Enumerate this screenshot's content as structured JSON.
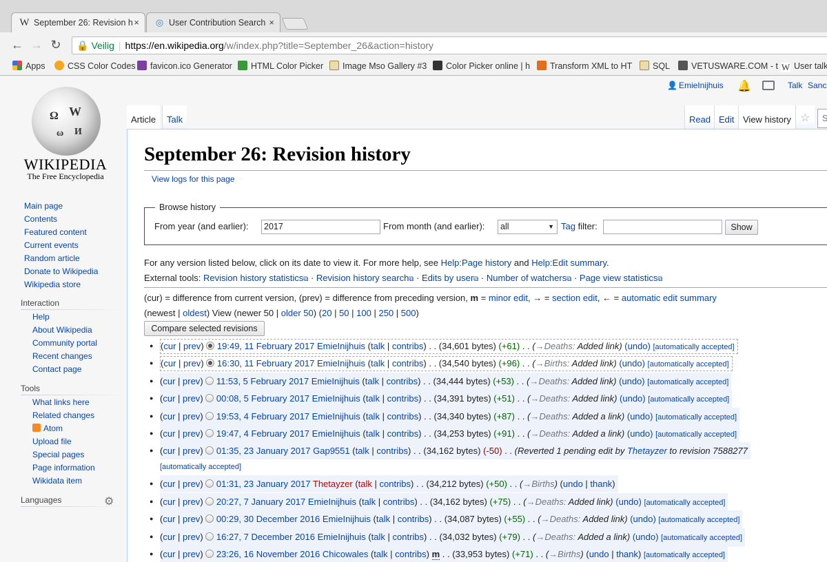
{
  "browser": {
    "tabs": [
      {
        "title": "September 26: Revision h",
        "close": "×",
        "icon": "W"
      },
      {
        "title": "User Contribution Search",
        "close": "×",
        "icon": "◎"
      }
    ],
    "address": {
      "secure_label": "Veilig",
      "host": "https://en.wikipedia.org",
      "path": "/w/index.php?title=September_26&action=history"
    },
    "bookmarks": [
      {
        "label": "Apps",
        "color": "#e04a3f"
      },
      {
        "label": "CSS Color Codes",
        "color": "#f5a623"
      },
      {
        "label": "favicon.ico Generator",
        "color": "#7b3fa0"
      },
      {
        "label": "HTML Color Picker",
        "color": "#3a9a3a"
      },
      {
        "label": "Image Mso Gallery #3",
        "color": "#c8b070"
      },
      {
        "label": "Color Picker online | h",
        "color": "#333333"
      },
      {
        "label": "Transform XML to HT",
        "color": "#e07020"
      },
      {
        "label": "SQL",
        "color": "#c8b070"
      },
      {
        "label": "VETUSWARE.COM - t",
        "color": "#555555"
      },
      {
        "label": "User talk:",
        "color": "#ffffff"
      }
    ]
  },
  "wiki": {
    "wordmark": "WIKIPEDIA",
    "tagline": "The Free Encyclopedia",
    "globe_glyphs": [
      "Ω",
      "W",
      "И",
      "ω"
    ],
    "nav": [
      "Main page",
      "Contents",
      "Featured content",
      "Current events",
      "Random article",
      "Donate to Wikipedia",
      "Wikipedia store"
    ],
    "interaction_heading": "Interaction",
    "interaction": [
      "Help",
      "About Wikipedia",
      "Community portal",
      "Recent changes",
      "Contact page"
    ],
    "tools_heading": "Tools",
    "tools": [
      "What links here",
      "Related changes",
      "Atom",
      "Upload file",
      "Special pages",
      "Page information",
      "Wikidata item"
    ],
    "languages_heading": "Languages",
    "user": "EmieInijhuis",
    "talk": "Talk",
    "sandbox": "Sanc",
    "tab_article": "Article",
    "tab_talk": "Talk",
    "tab_read": "Read",
    "tab_edit": "Edit",
    "tab_history": "View history",
    "search_placeholder": "S"
  },
  "page": {
    "title": "September 26: Revision history",
    "view_logs": "View logs for this page",
    "browse_legend": "Browse history",
    "from_year_label": "From year (and earlier):",
    "from_year_value": "2017",
    "from_month_label": "From month (and earlier):",
    "from_month_value": "all",
    "tag_link": "Tag",
    "tag_filter_label": " filter:",
    "show_button": "Show",
    "help_pre": "For any version listed below, click on its date to view it. For more help, see ",
    "help_link1": "Help:Page history",
    "help_mid": " and ",
    "help_link2": "Help:Edit summary",
    "help_post": ".",
    "ext_label": "External tools: ",
    "ext_tools": [
      "Revision history statistics",
      "Revision history search",
      "Edits by user",
      "Number of watchers",
      "Page view statistics"
    ],
    "legend_text": "(cur) = difference from current version, (prev) = difference from preceding version,",
    "legend_minor_bold": "m",
    "legend_minor": "minor edit",
    "legend_arrow1": "→ =",
    "legend_section": "section edit",
    "legend_arrow2": "← =",
    "legend_auto": "automatic edit summary",
    "pager_pre": "(newest | ",
    "pager_oldest": "oldest",
    "pager_mid": ") View (newer 50 | ",
    "pager_older": "older 50",
    "pager_paren": ") (",
    "pager_counts": [
      "20",
      "50",
      "100",
      "250",
      "500"
    ],
    "pager_end": ")",
    "compare_button": "Compare selected revisions"
  },
  "revisions": [
    {
      "date": "19:49, 11 February 2017",
      "user": "EmieInijhuis",
      "bytes": "(34,601 bytes)",
      "diff": "(+61)",
      "section": "Deaths:",
      "summary": "Added link)",
      "undo": "(undo)",
      "tag": "[automatically accepted]",
      "radio": "on",
      "boxed": true
    },
    {
      "date": "16:30, 11 February 2017",
      "user": "EmieInijhuis",
      "bytes": "(34,540 bytes)",
      "diff": "(+96)",
      "section": "Births:",
      "summary": "Added link)",
      "undo": "(undo)",
      "tag": "[automatically accepted]",
      "radio": "on",
      "boxed": true
    },
    {
      "date": "11:53, 5 February 2017",
      "user": "EmieInijhuis",
      "bytes": "(34,444 bytes)",
      "diff": "(+53)",
      "section": "Deaths:",
      "summary": "Added link)",
      "undo": "(undo)",
      "tag": "[automatically accepted]",
      "radio": "off",
      "boxed": false
    },
    {
      "date": "00:08, 5 February 2017",
      "user": "EmieInijhuis",
      "bytes": "(34,391 bytes)",
      "diff": "(+51)",
      "section": "Deaths:",
      "summary": "Added link)",
      "undo": "(undo)",
      "tag": "[automatically accepted]",
      "radio": "off",
      "boxed": false
    },
    {
      "date": "19:53, 4 February 2017",
      "user": "EmieInijhuis",
      "bytes": "(34,340 bytes)",
      "diff": "(+87)",
      "section": "Deaths:",
      "summary": "Added a link)",
      "undo": "(undo)",
      "tag": "[automatically accepted]",
      "radio": "off",
      "boxed": false
    },
    {
      "date": "19:47, 4 February 2017",
      "user": "EmieInijhuis",
      "bytes": "(34,253 bytes)",
      "diff": "(+91)",
      "section": "Deaths:",
      "summary": "Added a link)",
      "undo": "(undo)",
      "tag": "[automatically accepted]",
      "radio": "off",
      "boxed": false
    }
  ],
  "rev_gap": {
    "date": "01:35, 23 January 2017",
    "user": "Gap9551",
    "bytes": "(34,162 bytes)",
    "diff": "(-50)",
    "comment_pre": "(Reverted 1 pending edit by ",
    "comment_user": "Thetayzer",
    "comment_post": " to revision 7588277",
    "tag": "[automatically accepted]"
  },
  "rev_theta": {
    "date": "01:31, 23 January 2017",
    "user": "Thetayzer",
    "bytes": "(34,212 bytes)",
    "diff": "(+50)",
    "section": "Births",
    "undo": "undo",
    "thank": "thank"
  },
  "revisions2": [
    {
      "date": "20:27, 7 January 2017",
      "user": "EmieInijhuis",
      "bytes": "(34,162 bytes)",
      "diff": "(+75)",
      "section": "Deaths:",
      "summary": "Added link)",
      "undo": "(undo)",
      "tag": "[automatically accepted]"
    },
    {
      "date": "00:29, 30 December 2016",
      "user": "EmieInijhuis",
      "bytes": "(34,087 bytes)",
      "diff": "(+55)",
      "section": "Deaths:",
      "summary": "Added link)",
      "undo": "(undo)",
      "tag": "[automatically accepted]"
    },
    {
      "date": "16:27, 7 December 2016",
      "user": "EmieInijhuis",
      "bytes": "(34,032 bytes)",
      "diff": "(+79)",
      "section": "Deaths:",
      "summary": "Added a link)",
      "undo": "(undo)",
      "tag": "[automatically accepted]"
    }
  ],
  "rev_chico": {
    "date": "23:26, 16 November 2016",
    "user": "Chicowales",
    "minor": "m",
    "bytes": "(33,953 bytes)",
    "diff": "(+71)",
    "section": "Births",
    "undo": "undo",
    "thank": "thank",
    "tag": "[automatically accepted]"
  },
  "labels": {
    "cur": "cur",
    "prev": "prev",
    "talk": "talk",
    "contribs": "contribs",
    "dots": ". .",
    "arrow": "→"
  }
}
